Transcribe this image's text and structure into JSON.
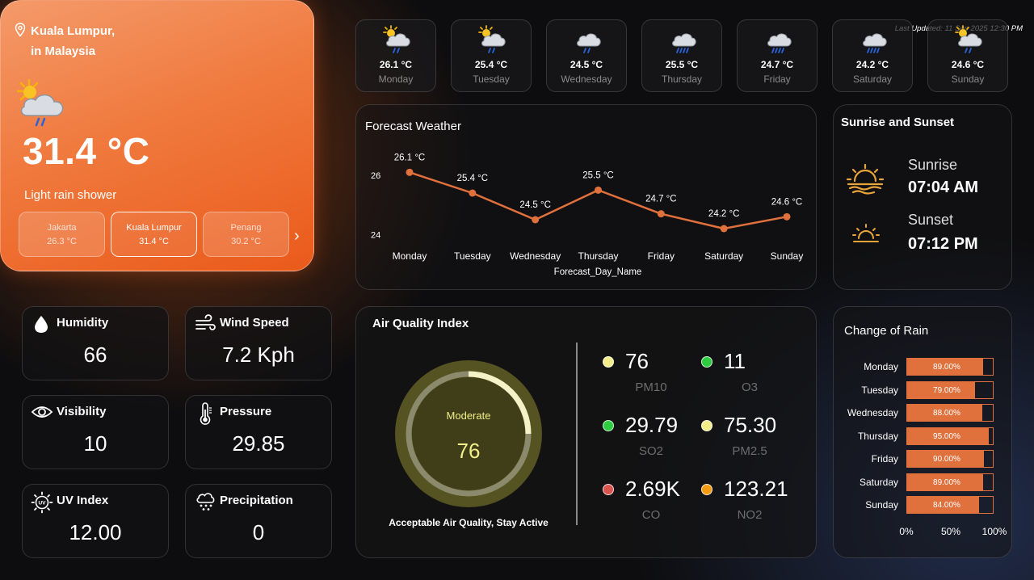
{
  "location": {
    "city": "Kuala Lumpur,",
    "country": "in Malaysia",
    "last_updated": "Last Updated: 11 Sep 2025 12:30 PM",
    "temperature": "31.4 °C",
    "condition": "Light rain shower",
    "cities": [
      {
        "name": "Jakarta",
        "temp": "26.3 °C"
      },
      {
        "name": "Kuala Lumpur",
        "temp": "31.4 °C"
      },
      {
        "name": "Penang",
        "temp": "30.2 °C"
      }
    ],
    "icon": "sun-cloud-rain-icon"
  },
  "week": [
    {
      "temp": "26.1 °C",
      "day": "Monday",
      "icon": "sun-cloud-rain-icon"
    },
    {
      "temp": "25.4 °C",
      "day": "Tuesday",
      "icon": "sun-cloud-rain-icon"
    },
    {
      "temp": "24.5 °C",
      "day": "Wednesday",
      "icon": "cloud-rain-icon"
    },
    {
      "temp": "25.5 °C",
      "day": "Thursday",
      "icon": "cloud-heavy-rain-icon"
    },
    {
      "temp": "24.7 °C",
      "day": "Friday",
      "icon": "cloud-heavy-rain-icon"
    },
    {
      "temp": "24.2 °C",
      "day": "Saturday",
      "icon": "cloud-heavy-rain-icon"
    },
    {
      "temp": "24.6 °C",
      "day": "Sunday",
      "icon": "sun-cloud-rain-icon"
    }
  ],
  "forecast": {
    "title": "Forecast Weather",
    "chart_data": {
      "type": "line",
      "categories": [
        "Monday",
        "Tuesday",
        "Wednesday",
        "Thursday",
        "Friday",
        "Saturday",
        "Sunday"
      ],
      "values": [
        26.1,
        25.4,
        24.5,
        25.5,
        24.7,
        24.2,
        24.6
      ],
      "data_labels": [
        "26.1 °C",
        "25.4 °C",
        "24.5 °C",
        "25.5 °C",
        "24.7 °C",
        "24.2 °C",
        "24.6 °C"
      ],
      "xlabel": "Forecast_Day_Name",
      "ylabel": "",
      "y_ticks": [
        "26",
        "24"
      ],
      "ylim": [
        23.6,
        26.6
      ],
      "color": "#e0703c"
    }
  },
  "sun": {
    "title": "Sunrise and Sunset",
    "sunrise_label": "Sunrise",
    "sunrise_time": "07:04 AM",
    "sunset_label": "Sunset",
    "sunset_time": "07:12 PM",
    "color": "#e8a33a"
  },
  "stats": {
    "humidity": {
      "label": "Humidity",
      "value": "66"
    },
    "wind": {
      "label": "Wind Speed",
      "value": "7.2 Kph"
    },
    "visibility": {
      "label": "Visibility",
      "value": "10"
    },
    "pressure": {
      "label": "Pressure",
      "value": "29.85"
    },
    "uv": {
      "label": "UV Index",
      "value": "12.00"
    },
    "precip": {
      "label": "Precipitation",
      "value": "0"
    }
  },
  "aqi": {
    "title": "Air Quality Index",
    "status": "Moderate",
    "value": "76",
    "gauge_fraction": 0.25,
    "note": "Acceptable Air Quality, Stay Active",
    "items": [
      {
        "value": "76",
        "label": "PM10",
        "color": "#f3ee8a"
      },
      {
        "value": "11",
        "label": "O3",
        "color": "#2ecc40"
      },
      {
        "value": "29.79",
        "label": "SO2",
        "color": "#2ecc40"
      },
      {
        "value": "75.30",
        "label": "PM2.5",
        "color": "#f3ee8a"
      },
      {
        "value": "2.69K",
        "label": "CO",
        "color": "#d9534f"
      },
      {
        "value": "123.21",
        "label": "NO2",
        "color": "#f39c12"
      }
    ]
  },
  "rain": {
    "title": "Change of Rain",
    "chart_data": {
      "type": "bar",
      "orientation": "horizontal",
      "categories": [
        "Monday",
        "Tuesday",
        "Wednesday",
        "Thursday",
        "Friday",
        "Saturday",
        "Sunday"
      ],
      "values": [
        89.0,
        79.0,
        88.0,
        95.0,
        90.0,
        89.0,
        84.0
      ],
      "labels": [
        "89.00%",
        "79.00%",
        "88.00%",
        "95.00%",
        "90.00%",
        "89.00%",
        "84.00%"
      ],
      "x_ticks": [
        "0%",
        "50%",
        "100%"
      ],
      "xlim": [
        0,
        100
      ],
      "color": "#e0703c"
    }
  }
}
